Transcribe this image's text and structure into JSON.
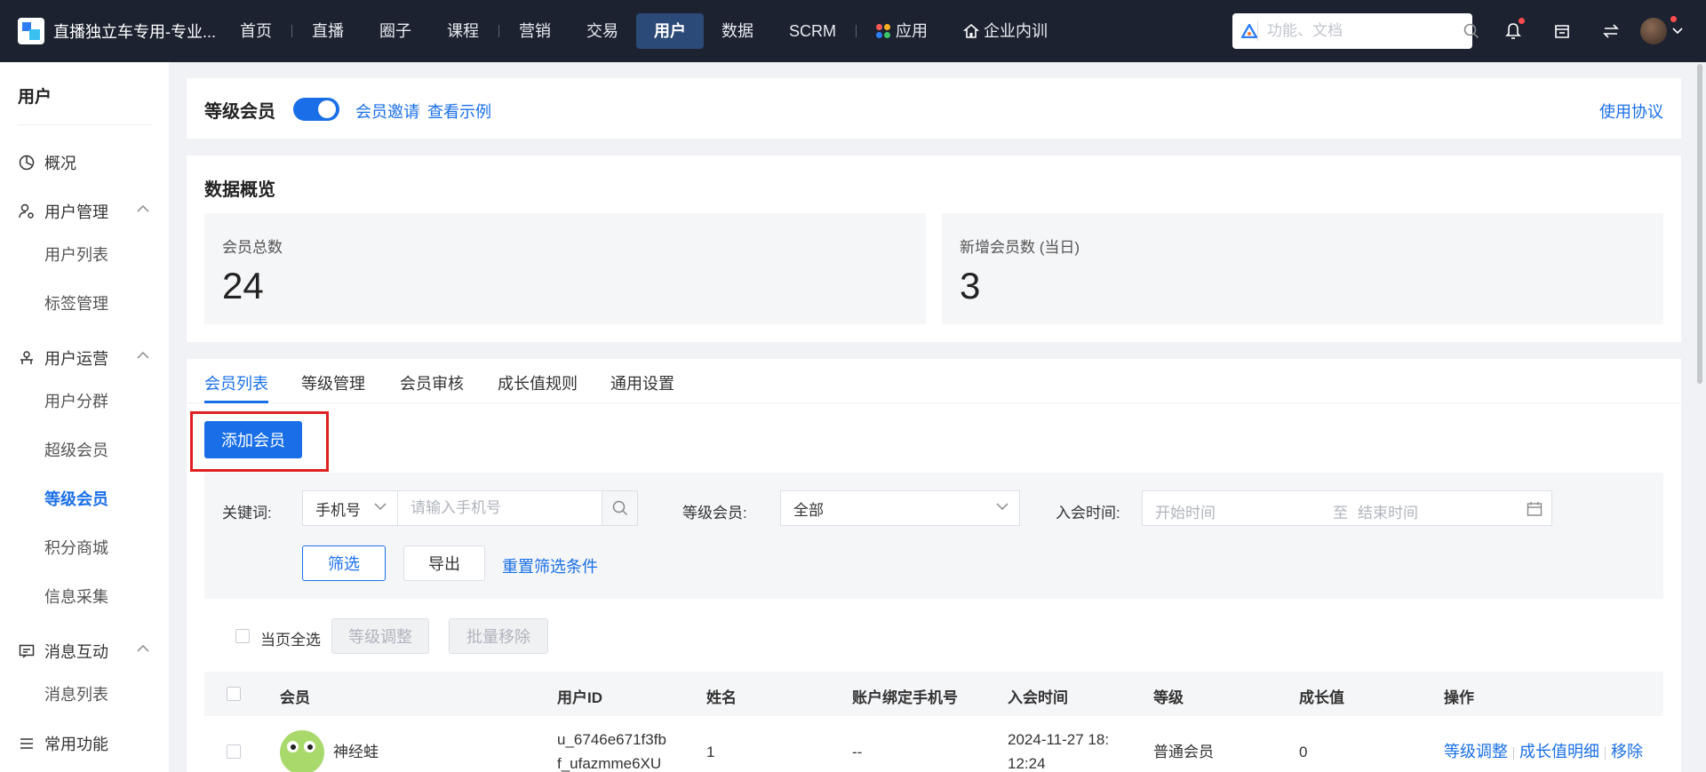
{
  "app": {
    "title": "直播独立车专用-专业..."
  },
  "nav": {
    "items": [
      {
        "label": "首页"
      },
      {
        "label": "直播"
      },
      {
        "label": "圈子"
      },
      {
        "label": "课程"
      },
      {
        "label": "营销"
      },
      {
        "label": "交易"
      },
      {
        "label": "用户"
      },
      {
        "label": "数据"
      },
      {
        "label": "SCRM"
      },
      {
        "label": "应用"
      },
      {
        "label": "企业内训"
      }
    ],
    "active": "用户",
    "search_placeholder": "功能、文档"
  },
  "sidebar": {
    "title": "用户",
    "overview": "概况",
    "groups": [
      {
        "label": "用户管理",
        "items": [
          "用户列表",
          "标签管理"
        ]
      },
      {
        "label": "用户运营",
        "items": [
          "用户分群",
          "超级会员",
          "等级会员",
          "积分商城",
          "信息采集"
        ]
      },
      {
        "label": "消息互动",
        "items": [
          "消息列表"
        ]
      }
    ],
    "common": "常用功能",
    "active_item": "等级会员"
  },
  "header": {
    "title": "等级会员",
    "toggle_on": true,
    "link_invite": "会员邀请",
    "link_example": "查看示例",
    "link_agreement": "使用协议"
  },
  "overview": {
    "title": "数据概览",
    "stats": [
      {
        "label": "会员总数",
        "value": "24"
      },
      {
        "label": "新增会员数 (当日)",
        "value": "3"
      }
    ]
  },
  "tabs": [
    "会员列表",
    "等级管理",
    "会员审核",
    "成长值规则",
    "通用设置"
  ],
  "active_tab": "会员列表",
  "add_button": "添加会员",
  "filter": {
    "keyword_label": "关键词:",
    "keyword_type": "手机号",
    "keyword_placeholder": "请输入手机号",
    "level_label": "等级会员:",
    "level_value": "全部",
    "date_label": "入会时间:",
    "date_start": "开始时间",
    "date_to": "至",
    "date_end": "结束时间",
    "btn_filter": "筛选",
    "btn_export": "导出",
    "btn_reset": "重置筛选条件"
  },
  "bulk": {
    "select_all": "当页全选",
    "btn_adjust": "等级调整",
    "btn_remove": "批量移除"
  },
  "table": {
    "columns": [
      "会员",
      "用户ID",
      "姓名",
      "账户绑定手机号",
      "入会时间",
      "等级",
      "成长值",
      "操作"
    ],
    "rows": [
      {
        "member": "神经蛙",
        "user_id_1": "u_6746e671f3fb",
        "user_id_2": "f_ufazmme6XU",
        "name": "1",
        "phone": "--",
        "join_time_1": "2024-11-27 18:",
        "join_time_2": "12:24",
        "level": "普通会员",
        "growth": "0",
        "ops": [
          "等级调整",
          "成长值明细",
          "移除"
        ]
      }
    ]
  },
  "colors": {
    "primary": "#1a6fe8",
    "nav_bg": "#1c2230",
    "highlight": "#e02020"
  }
}
